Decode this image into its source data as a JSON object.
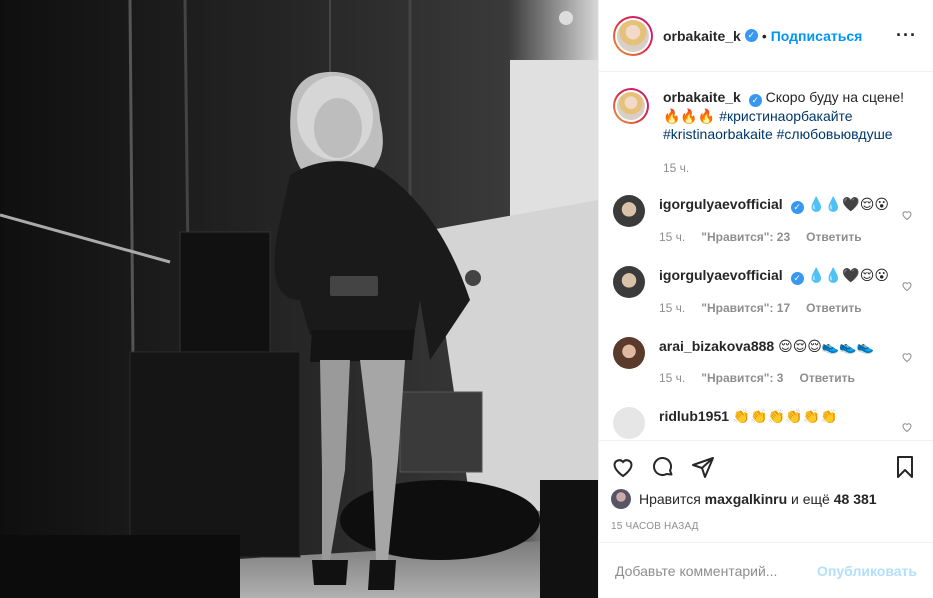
{
  "post": {
    "author": "orbakaite_k",
    "follow_label": "Подписаться",
    "dot": "•",
    "more": "···",
    "caption": {
      "username": "orbakaite_k",
      "text": "Скоро буду на сцене!",
      "emoji": "🔥🔥🔥",
      "hashtags": [
        "#кристинаорбакайте",
        "#kristinaorbakaite",
        "#слюбовьювдуше"
      ],
      "time": "15 ч."
    },
    "comments": [
      {
        "username": "igorgulyaevofficial",
        "verified": true,
        "text": "💧💧🖤😌😮",
        "time": "15 ч.",
        "likes_label": "\"Нравится\": 23",
        "reply": "Ответить"
      },
      {
        "username": "igorgulyaevofficial",
        "verified": true,
        "text": "💧💧🖤😌😮",
        "time": "15 ч.",
        "likes_label": "\"Нравится\": 17",
        "reply": "Ответить"
      },
      {
        "username": "arai_bizakova888",
        "verified": false,
        "text": "😌😌😌👟👟👟",
        "time": "15 ч.",
        "likes_label": "\"Нравится\": 3",
        "reply": "Ответить"
      },
      {
        "username": "ridlub1951",
        "verified": false,
        "text": "👏👏👏👏👏👏",
        "time": "",
        "likes_label": "",
        "reply": ""
      }
    ],
    "likes": {
      "prefix": "Нравится",
      "user": "maxgalkinru",
      "middle": "и ещё",
      "count": "48 381"
    },
    "posted_ago": "15 ЧАСОВ НАЗАД",
    "comment_input": {
      "placeholder": "Добавьте комментарий...",
      "publish": "Опубликовать"
    }
  },
  "colors": {
    "accent": "#0095f6",
    "verified": "#3897f0",
    "muted": "#8e8e8e",
    "hashtag": "#00376b"
  },
  "icons": [
    "heart-icon",
    "comment-icon",
    "share-icon",
    "bookmark-icon",
    "verified-icon",
    "more-icon"
  ]
}
